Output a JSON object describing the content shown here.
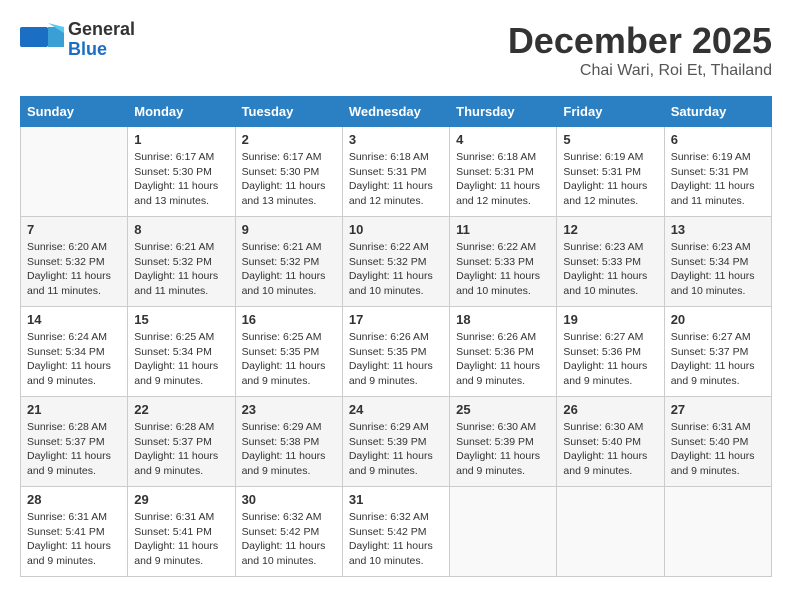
{
  "header": {
    "logo_general": "General",
    "logo_blue": "Blue",
    "month": "December 2025",
    "location": "Chai Wari, Roi Et, Thailand"
  },
  "days_of_week": [
    "Sunday",
    "Monday",
    "Tuesday",
    "Wednesday",
    "Thursday",
    "Friday",
    "Saturday"
  ],
  "weeks": [
    [
      {
        "day": "",
        "info": ""
      },
      {
        "day": "1",
        "info": "Sunrise: 6:17 AM\nSunset: 5:30 PM\nDaylight: 11 hours\nand 13 minutes."
      },
      {
        "day": "2",
        "info": "Sunrise: 6:17 AM\nSunset: 5:30 PM\nDaylight: 11 hours\nand 13 minutes."
      },
      {
        "day": "3",
        "info": "Sunrise: 6:18 AM\nSunset: 5:31 PM\nDaylight: 11 hours\nand 12 minutes."
      },
      {
        "day": "4",
        "info": "Sunrise: 6:18 AM\nSunset: 5:31 PM\nDaylight: 11 hours\nand 12 minutes."
      },
      {
        "day": "5",
        "info": "Sunrise: 6:19 AM\nSunset: 5:31 PM\nDaylight: 11 hours\nand 12 minutes."
      },
      {
        "day": "6",
        "info": "Sunrise: 6:19 AM\nSunset: 5:31 PM\nDaylight: 11 hours\nand 11 minutes."
      }
    ],
    [
      {
        "day": "7",
        "info": "Sunrise: 6:20 AM\nSunset: 5:32 PM\nDaylight: 11 hours\nand 11 minutes."
      },
      {
        "day": "8",
        "info": "Sunrise: 6:21 AM\nSunset: 5:32 PM\nDaylight: 11 hours\nand 11 minutes."
      },
      {
        "day": "9",
        "info": "Sunrise: 6:21 AM\nSunset: 5:32 PM\nDaylight: 11 hours\nand 10 minutes."
      },
      {
        "day": "10",
        "info": "Sunrise: 6:22 AM\nSunset: 5:32 PM\nDaylight: 11 hours\nand 10 minutes."
      },
      {
        "day": "11",
        "info": "Sunrise: 6:22 AM\nSunset: 5:33 PM\nDaylight: 11 hours\nand 10 minutes."
      },
      {
        "day": "12",
        "info": "Sunrise: 6:23 AM\nSunset: 5:33 PM\nDaylight: 11 hours\nand 10 minutes."
      },
      {
        "day": "13",
        "info": "Sunrise: 6:23 AM\nSunset: 5:34 PM\nDaylight: 11 hours\nand 10 minutes."
      }
    ],
    [
      {
        "day": "14",
        "info": "Sunrise: 6:24 AM\nSunset: 5:34 PM\nDaylight: 11 hours\nand 9 minutes."
      },
      {
        "day": "15",
        "info": "Sunrise: 6:25 AM\nSunset: 5:34 PM\nDaylight: 11 hours\nand 9 minutes."
      },
      {
        "day": "16",
        "info": "Sunrise: 6:25 AM\nSunset: 5:35 PM\nDaylight: 11 hours\nand 9 minutes."
      },
      {
        "day": "17",
        "info": "Sunrise: 6:26 AM\nSunset: 5:35 PM\nDaylight: 11 hours\nand 9 minutes."
      },
      {
        "day": "18",
        "info": "Sunrise: 6:26 AM\nSunset: 5:36 PM\nDaylight: 11 hours\nand 9 minutes."
      },
      {
        "day": "19",
        "info": "Sunrise: 6:27 AM\nSunset: 5:36 PM\nDaylight: 11 hours\nand 9 minutes."
      },
      {
        "day": "20",
        "info": "Sunrise: 6:27 AM\nSunset: 5:37 PM\nDaylight: 11 hours\nand 9 minutes."
      }
    ],
    [
      {
        "day": "21",
        "info": "Sunrise: 6:28 AM\nSunset: 5:37 PM\nDaylight: 11 hours\nand 9 minutes."
      },
      {
        "day": "22",
        "info": "Sunrise: 6:28 AM\nSunset: 5:37 PM\nDaylight: 11 hours\nand 9 minutes."
      },
      {
        "day": "23",
        "info": "Sunrise: 6:29 AM\nSunset: 5:38 PM\nDaylight: 11 hours\nand 9 minutes."
      },
      {
        "day": "24",
        "info": "Sunrise: 6:29 AM\nSunset: 5:39 PM\nDaylight: 11 hours\nand 9 minutes."
      },
      {
        "day": "25",
        "info": "Sunrise: 6:30 AM\nSunset: 5:39 PM\nDaylight: 11 hours\nand 9 minutes."
      },
      {
        "day": "26",
        "info": "Sunrise: 6:30 AM\nSunset: 5:40 PM\nDaylight: 11 hours\nand 9 minutes."
      },
      {
        "day": "27",
        "info": "Sunrise: 6:31 AM\nSunset: 5:40 PM\nDaylight: 11 hours\nand 9 minutes."
      }
    ],
    [
      {
        "day": "28",
        "info": "Sunrise: 6:31 AM\nSunset: 5:41 PM\nDaylight: 11 hours\nand 9 minutes."
      },
      {
        "day": "29",
        "info": "Sunrise: 6:31 AM\nSunset: 5:41 PM\nDaylight: 11 hours\nand 9 minutes."
      },
      {
        "day": "30",
        "info": "Sunrise: 6:32 AM\nSunset: 5:42 PM\nDaylight: 11 hours\nand 10 minutes."
      },
      {
        "day": "31",
        "info": "Sunrise: 6:32 AM\nSunset: 5:42 PM\nDaylight: 11 hours\nand 10 minutes."
      },
      {
        "day": "",
        "info": ""
      },
      {
        "day": "",
        "info": ""
      },
      {
        "day": "",
        "info": ""
      }
    ]
  ]
}
